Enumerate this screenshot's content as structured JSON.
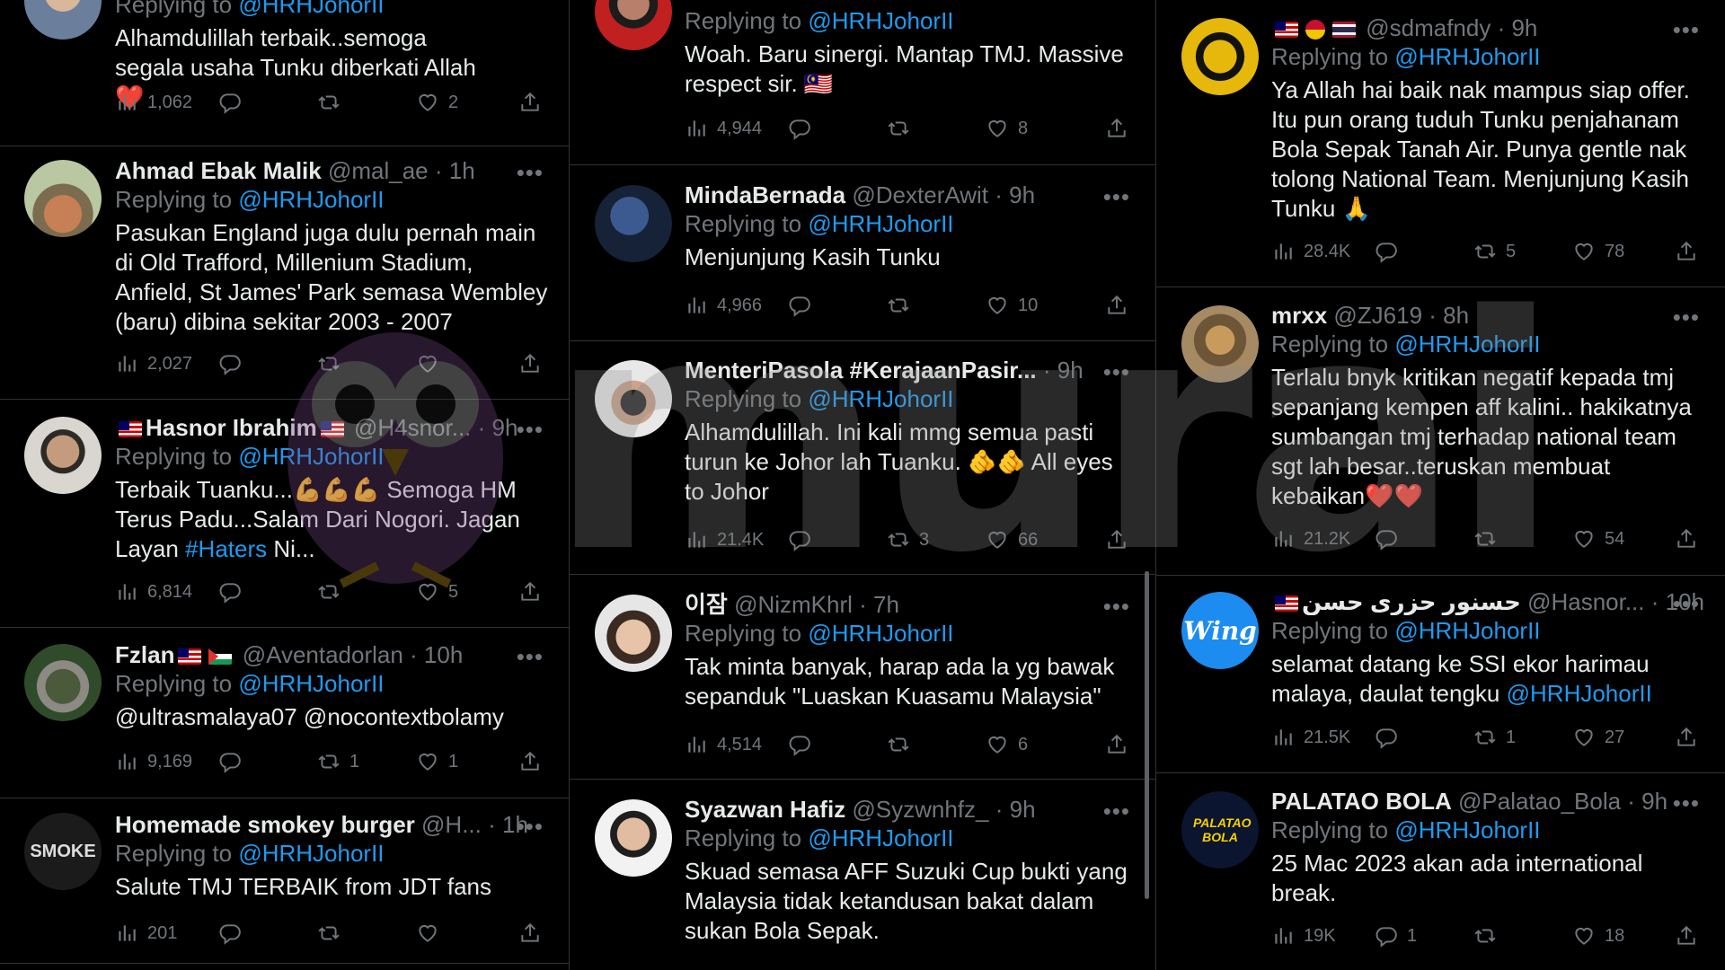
{
  "watermark": "murai",
  "col1": [
    {
      "name": "",
      "handle": "",
      "time": "",
      "reply_prefix": "Replying to ",
      "reply_to": "@HRHJohorII",
      "text": "Alhamdulillah terbaik..semoga segala usaha Tunku diberkati Allah❤️",
      "views": "1,062",
      "replies": "",
      "retweets": "",
      "likes": "2"
    },
    {
      "name": "Ahmad Ebak Malik",
      "handle": "@mal_ae · 1h",
      "reply_prefix": "Replying to ",
      "reply_to": "@HRHJohorII",
      "text": "Pasukan England juga dulu pernah main di Old Trafford, Millenium Stadium, Anfield, St James' Park semasa Wembley (baru) dibina sekitar 2003 - 2007",
      "views": "2,027",
      "replies": "",
      "retweets": "",
      "likes": ""
    },
    {
      "name": "Hasnor Ibrahim",
      "handle": "@H4snor... · 9h",
      "reply_prefix": "Replying to ",
      "reply_to": "@HRHJohorII",
      "text_a": "Terbaik Tuanku...💪💪💪 Semoga HM Terus Padu...Salam Dari Nogori. Jagan Layan ",
      "hashtag": "#Haters",
      "text_b": " Ni...",
      "views": "6,814",
      "replies": "",
      "retweets": "",
      "likes": "5"
    },
    {
      "name": "Fzlan",
      "handle": "@Aventadorlan · 10h",
      "reply_prefix": "Replying to ",
      "reply_to": "@HRHJohorII",
      "text": "@ultrasmalaya07 @nocontextbolamy",
      "views": "9,169",
      "replies": "",
      "retweets": "1",
      "likes": "1"
    },
    {
      "name": "Homemade smokey burger",
      "handle": "@H... · 1h",
      "reply_prefix": "Replying to ",
      "reply_to": "@HRHJohorII",
      "text": "Salute TMJ TERBAIK from JDT fans",
      "views": "201",
      "replies": "",
      "retweets": "",
      "likes": ""
    }
  ],
  "col2": [
    {
      "reply_prefix": "Replying to ",
      "reply_to": "@HRHJohorII",
      "text": "Woah. Baru sinergi. Mantap TMJ. Massive respect sir. 🇲🇾",
      "views": "4,944",
      "replies": "",
      "retweets": "",
      "likes": "8"
    },
    {
      "name": "MindaBernada",
      "handle": "@DexterAwit · 9h",
      "reply_prefix": "Replying to ",
      "reply_to": "@HRHJohorII",
      "text": "Menjunjung Kasih Tunku",
      "views": "4,966",
      "replies": "",
      "retweets": "",
      "likes": "10"
    },
    {
      "name": "MenteriPasola #KerajaanPasir...",
      "handle": "· 9h",
      "reply_prefix": "Replying to ",
      "reply_to": "@HRHJohorII",
      "text": "Alhamdulillah. Ini kali mmg semua pasti turun ke Johor lah Tuanku. 🫵🫵 All eyes to Johor",
      "views": "21.4K",
      "replies": "",
      "retweets": "3",
      "likes": "66"
    },
    {
      "name": "이잠",
      "handle": "@NizmKhrl · 7h",
      "reply_prefix": "Replying to ",
      "reply_to": "@HRHJohorII",
      "text": "Tak minta banyak, harap ada la yg bawak sepanduk \"Luaskan Kuasamu Malaysia\"",
      "views": "4,514",
      "replies": "",
      "retweets": "",
      "likes": "6"
    },
    {
      "name": "Syazwan Hafiz",
      "handle": "@Syzwnhfz_ · 9h",
      "reply_prefix": "Replying to ",
      "reply_to": "@HRHJohorII",
      "text": "Skuad semasa AFF Suzuki Cup bukti yang Malaysia tidak ketandusan bakat dalam sukan Bola Sepak."
    }
  ],
  "col3": [
    {
      "name": "",
      "handle": "@sdmafndy · 9h",
      "reply_prefix": "Replying to ",
      "reply_to": "@HRHJohorII",
      "text": "Ya Allah hai baik nak mampus siap offer. Itu pun orang tuduh Tunku penjahanam Bola Sepak Tanah Air. Punya gentle nak tolong National Team. Menjunjung Kasih Tunku 🙏",
      "views": "28.4K",
      "replies": "",
      "retweets": "5",
      "likes": "78"
    },
    {
      "name": "mrxx",
      "handle": "@ZJ619 · 8h",
      "reply_prefix": "Replying to ",
      "reply_to": "@HRHJohorII",
      "text": "Terlalu bnyk kritikan negatif kepada tmj sepanjang kempen aff kalini.. hakikatnya sumbangan tmj terhadap national team sgt lah besar..teruskan membuat kebaikan❤️❤️",
      "views": "21.2K",
      "replies": "",
      "retweets": "",
      "likes": "54"
    },
    {
      "name": "حسنور حزرى حسن",
      "handle": "@Hasnor... · 10h",
      "reply_prefix": "Replying to ",
      "reply_to": "@HRHJohorII",
      "text": "selamat datang ke SSI ekor harimau malaya, daulat tengku ",
      "mention": "@HRHJohorII",
      "views": "21.5K",
      "replies": "",
      "retweets": "1",
      "likes": "27"
    },
    {
      "name": "PALATAO BOLA",
      "handle": "@Palatao_Bola · 9h",
      "reply_prefix": "Replying to ",
      "reply_to": "@HRHJohorII",
      "text": "25 Mac 2023 akan ada international break.",
      "views": "19K",
      "replies": "1",
      "retweets": "",
      "likes": "18"
    }
  ],
  "avatars": {
    "wing": "Wing",
    "palatao": "PALATAO BOLA",
    "smoke": "SMOKE"
  }
}
